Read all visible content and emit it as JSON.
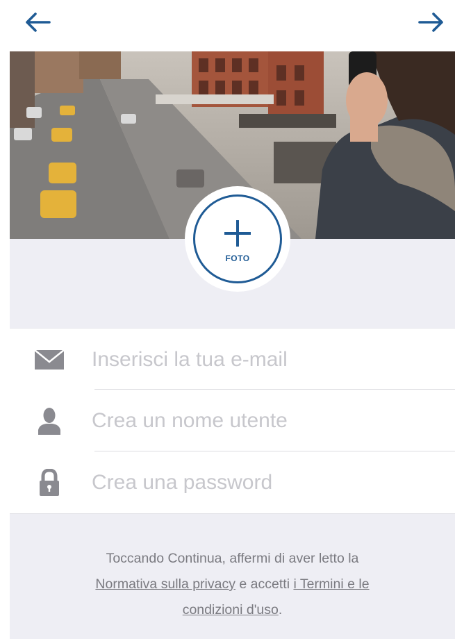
{
  "nav": {
    "back_icon": "arrow-left-icon",
    "next_icon": "arrow-right-icon",
    "accent_color": "#1f5b95"
  },
  "cover": {
    "image": "city-street-photo"
  },
  "photo": {
    "icon": "plus-icon",
    "label": "FOTO"
  },
  "form": {
    "email": {
      "icon": "envelope-icon",
      "placeholder": "Inserisci la tua e-mail",
      "value": ""
    },
    "username": {
      "icon": "user-icon",
      "placeholder": "Crea un nome utente",
      "value": ""
    },
    "password": {
      "icon": "lock-icon",
      "placeholder": "Crea una password",
      "value": ""
    }
  },
  "terms": {
    "text_before": "Toccando Continua, affermi di aver letto la",
    "privacy_link": "Normativa sulla privacy",
    "text_middle": " e accetti ",
    "terms_link_1": "i Termini e le",
    "terms_link_2": "condizioni d'uso",
    "text_end": "."
  }
}
